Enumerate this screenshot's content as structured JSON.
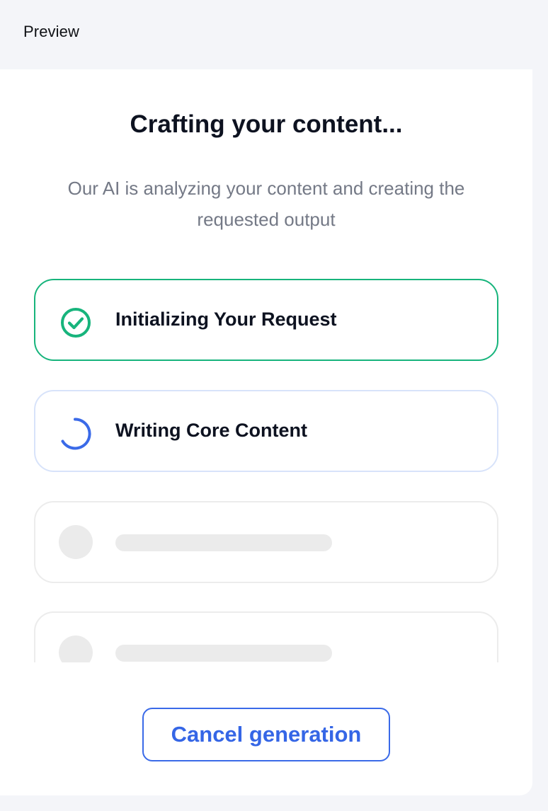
{
  "header": {
    "title": "Preview"
  },
  "main": {
    "heading": "Crafting your content...",
    "subtitle": "Our AI is analyzing your content and creating the requested output"
  },
  "steps": [
    {
      "label": "Initializing Your Request",
      "status": "completed",
      "icon": "check-circle-icon"
    },
    {
      "label": "Writing Core Content",
      "status": "in-progress",
      "icon": "spinner-icon"
    },
    {
      "label": "",
      "status": "pending"
    },
    {
      "label": "",
      "status": "pending"
    }
  ],
  "actions": {
    "cancel_label": "Cancel generation"
  },
  "colors": {
    "success": "#17b47c",
    "accent": "#3a6ae8",
    "header_bg": "#f4f5f9",
    "placeholder": "#ebebeb"
  }
}
